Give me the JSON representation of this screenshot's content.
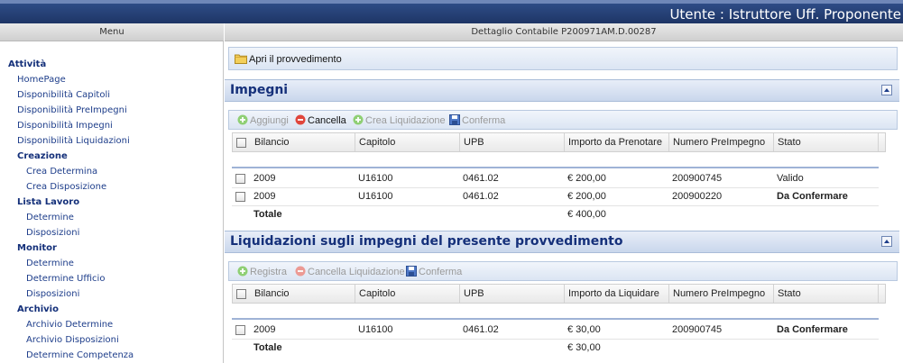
{
  "topbar": {
    "user_label": "Utente : Istruttore Uff. Proponente"
  },
  "menu": {
    "header": "Menu",
    "items": [
      {
        "label": "Attività",
        "kind": "section"
      },
      {
        "label": "HomePage",
        "kind": "link"
      },
      {
        "label": "Disponibilità Capitoli",
        "kind": "link"
      },
      {
        "label": "Disponibilità PreImpegni",
        "kind": "link"
      },
      {
        "label": "Disponibilità Impegni",
        "kind": "link"
      },
      {
        "label": "Disponibilità Liquidazioni",
        "kind": "link"
      },
      {
        "label": "Creazione",
        "kind": "section"
      },
      {
        "label": "Crea Determina",
        "kind": "link"
      },
      {
        "label": "Crea Disposizione",
        "kind": "link"
      },
      {
        "label": "Lista Lavoro",
        "kind": "section"
      },
      {
        "label": "Determine",
        "kind": "link"
      },
      {
        "label": "Disposizioni",
        "kind": "link"
      },
      {
        "label": "Monitor",
        "kind": "section"
      },
      {
        "label": "Determine",
        "kind": "link"
      },
      {
        "label": "Determine Ufficio",
        "kind": "link"
      },
      {
        "label": "Disposizioni",
        "kind": "link"
      },
      {
        "label": "Archivio",
        "kind": "section"
      },
      {
        "label": "Archivio Determine",
        "kind": "link"
      },
      {
        "label": "Archivio Disposizioni",
        "kind": "link"
      },
      {
        "label": "Determine Competenza",
        "kind": "link"
      }
    ]
  },
  "main": {
    "header": "Dettaglio Contabile P200971AM.D.00287",
    "open_button": "Apri il provvedimento",
    "impegni": {
      "title": "Impegni",
      "toolbar": {
        "add": "Aggiungi",
        "delete": "Cancella",
        "create_liq": "Crea Liquidazione",
        "confirm": "Conferma"
      },
      "columns": [
        "Bilancio",
        "Capitolo",
        "UPB",
        "Importo da Prenotare",
        "Numero PreImpegno",
        "Stato"
      ],
      "rows": [
        {
          "bilancio": "2009",
          "capitolo": "U16100",
          "upb": "0461.02",
          "importo": "€ 200,00",
          "numero": "200900745",
          "stato": "Valido"
        },
        {
          "bilancio": "2009",
          "capitolo": "U16100",
          "upb": "0461.02",
          "importo": "€ 200,00",
          "numero": "200900220",
          "stato": "Da Confermare"
        }
      ],
      "total": {
        "label": "Totale",
        "importo": "€ 400,00"
      }
    },
    "liquidazioni": {
      "title": "Liquidazioni sugli impegni del presente provvedimento",
      "toolbar": {
        "register": "Registra",
        "delete": "Cancella Liquidazione",
        "confirm": "Conferma"
      },
      "columns": [
        "Bilancio",
        "Capitolo",
        "UPB",
        "Importo da Liquidare",
        "Numero PreImpegno",
        "Stato"
      ],
      "rows": [
        {
          "bilancio": "2009",
          "capitolo": "U16100",
          "upb": "0461.02",
          "importo": "€ 30,00",
          "numero": "200900745",
          "stato": "Da Confermare"
        }
      ],
      "total": {
        "label": "Totale",
        "importo": "€ 30,00"
      }
    }
  },
  "colors": {
    "banner": "#1e3566",
    "link": "#1d3d8a",
    "section": "#14307a",
    "panel_head": "#c9d7ec"
  }
}
